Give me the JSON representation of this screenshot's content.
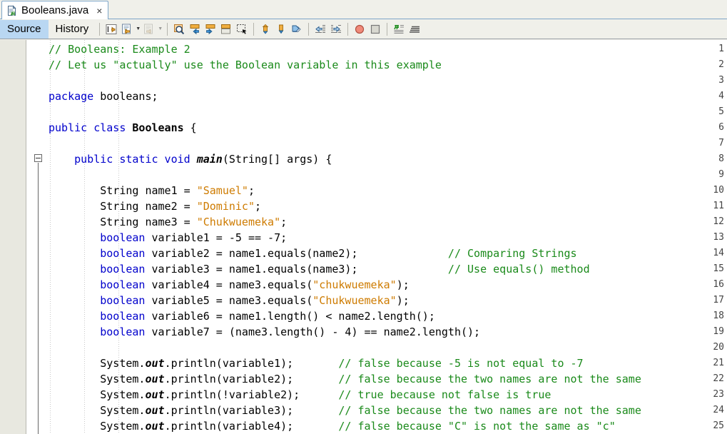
{
  "window": {
    "app": "NetBeans IDE Java Editor"
  },
  "tab": {
    "icon": "java-file-icon",
    "label": "Booleans.java",
    "close": "×"
  },
  "view_tabs": [
    {
      "label": "Source",
      "active": true
    },
    {
      "label": "History",
      "active": false
    }
  ],
  "toolbar": {
    "groups": [
      {
        "name": "navigation-history",
        "buttons": [
          {
            "name": "last-edit-button",
            "icon": "last-edit-icon",
            "enabled": true
          },
          {
            "name": "back-button",
            "icon": "back-arrow-icon",
            "enabled": true,
            "dropdown": true
          },
          {
            "name": "forward-button",
            "icon": "forward-arrow-icon",
            "enabled": false,
            "dropdown": true
          }
        ]
      },
      {
        "name": "find-and-bookmarks",
        "buttons": [
          {
            "name": "find-selection-button",
            "icon": "magnifier-icon",
            "enabled": true
          },
          {
            "name": "find-previous-button",
            "icon": "find-previous-icon",
            "enabled": true
          },
          {
            "name": "find-next-button",
            "icon": "find-next-icon",
            "enabled": true
          },
          {
            "name": "toggle-highlight-button",
            "icon": "toggle-highlight-icon",
            "enabled": true
          },
          {
            "name": "toggle-rectangular-selection-button",
            "icon": "rect-selection-icon",
            "enabled": true
          }
        ]
      },
      {
        "name": "bookmark-navigation",
        "buttons": [
          {
            "name": "previous-bookmark-button",
            "icon": "bookmark-up-icon",
            "enabled": true
          },
          {
            "name": "next-bookmark-button",
            "icon": "bookmark-down-icon",
            "enabled": true
          },
          {
            "name": "toggle-bookmark-button",
            "icon": "toggle-bookmark-icon",
            "enabled": true
          }
        ]
      },
      {
        "name": "indentation",
        "buttons": [
          {
            "name": "shift-left-button",
            "icon": "shift-left-icon",
            "enabled": true
          },
          {
            "name": "shift-right-button",
            "icon": "shift-right-icon",
            "enabled": true
          }
        ]
      },
      {
        "name": "recording",
        "buttons": [
          {
            "name": "start-macro-recording-button",
            "icon": "record-circle-icon",
            "enabled": true
          },
          {
            "name": "stop-macro-recording-button",
            "icon": "stop-square-icon",
            "enabled": true
          }
        ]
      },
      {
        "name": "formatting",
        "buttons": [
          {
            "name": "toggle-comment-button",
            "icon": "comment-lines-icon",
            "enabled": true
          },
          {
            "name": "format-button",
            "icon": "format-lines-icon",
            "enabled": true
          }
        ]
      }
    ]
  },
  "editor": {
    "first_visible_line": 1,
    "last_visible_line": 25,
    "fold_line": 8,
    "colors": {
      "keyword": "#0000cc",
      "string": "#ce7b00",
      "comment": "#1a8a1a",
      "text": "#000000",
      "background": "#ffffff",
      "gutter_background": "#e8e8e0",
      "active_tab_highlight": "#b9d7f2"
    },
    "lines": [
      {
        "n": 1,
        "tokens": [
          {
            "t": "cmt",
            "v": "// Booleans: Example 2"
          }
        ]
      },
      {
        "n": 2,
        "tokens": [
          {
            "t": "cmt",
            "v": "// Let us \"actually\" use the Boolean variable in this example"
          }
        ]
      },
      {
        "n": 3,
        "tokens": []
      },
      {
        "n": 4,
        "tokens": [
          {
            "t": "kw",
            "v": "package"
          },
          {
            "t": "p",
            "v": " booleans;"
          }
        ]
      },
      {
        "n": 5,
        "tokens": []
      },
      {
        "n": 6,
        "tokens": [
          {
            "t": "kw",
            "v": "public class"
          },
          {
            "t": "p",
            "v": " "
          },
          {
            "t": "clsname",
            "v": "Booleans"
          },
          {
            "t": "p",
            "v": " {"
          }
        ]
      },
      {
        "n": 7,
        "tokens": []
      },
      {
        "n": 8,
        "tokens": [
          {
            "t": "p",
            "v": "    "
          },
          {
            "t": "kw",
            "v": "public static void"
          },
          {
            "t": "p",
            "v": " "
          },
          {
            "t": "mth",
            "v": "main"
          },
          {
            "t": "p",
            "v": "(String[] args) {"
          }
        ]
      },
      {
        "n": 9,
        "tokens": []
      },
      {
        "n": 10,
        "tokens": [
          {
            "t": "p",
            "v": "        String name1 = "
          },
          {
            "t": "str",
            "v": "\"Samuel\""
          },
          {
            "t": "p",
            "v": ";"
          }
        ]
      },
      {
        "n": 11,
        "tokens": [
          {
            "t": "p",
            "v": "        String name2 = "
          },
          {
            "t": "str",
            "v": "\"Dominic\""
          },
          {
            "t": "p",
            "v": ";"
          }
        ]
      },
      {
        "n": 12,
        "tokens": [
          {
            "t": "p",
            "v": "        String name3 = "
          },
          {
            "t": "str",
            "v": "\"Chukwuemeka\""
          },
          {
            "t": "p",
            "v": ";"
          }
        ]
      },
      {
        "n": 13,
        "tokens": [
          {
            "t": "p",
            "v": "        "
          },
          {
            "t": "kw",
            "v": "boolean"
          },
          {
            "t": "p",
            "v": " variable1 = -5 == -7;"
          }
        ]
      },
      {
        "n": 14,
        "tokens": [
          {
            "t": "p",
            "v": "        "
          },
          {
            "t": "kw",
            "v": "boolean"
          },
          {
            "t": "p",
            "v": " variable2 = name1.equals(name2);"
          },
          {
            "t": "p",
            "v": "              "
          },
          {
            "t": "cmt",
            "v": "// Comparing Strings"
          }
        ]
      },
      {
        "n": 15,
        "tokens": [
          {
            "t": "p",
            "v": "        "
          },
          {
            "t": "kw",
            "v": "boolean"
          },
          {
            "t": "p",
            "v": " variable3 = name1.equals(name3);"
          },
          {
            "t": "p",
            "v": "              "
          },
          {
            "t": "cmt",
            "v": "// Use equals() method"
          }
        ]
      },
      {
        "n": 16,
        "tokens": [
          {
            "t": "p",
            "v": "        "
          },
          {
            "t": "kw",
            "v": "boolean"
          },
          {
            "t": "p",
            "v": " variable4 = name3.equals("
          },
          {
            "t": "str",
            "v": "\"chukwuemeka\""
          },
          {
            "t": "p",
            "v": ");"
          }
        ]
      },
      {
        "n": 17,
        "tokens": [
          {
            "t": "p",
            "v": "        "
          },
          {
            "t": "kw",
            "v": "boolean"
          },
          {
            "t": "p",
            "v": " variable5 = name3.equals("
          },
          {
            "t": "str",
            "v": "\"Chukwuemeka\""
          },
          {
            "t": "p",
            "v": ");"
          }
        ]
      },
      {
        "n": 18,
        "tokens": [
          {
            "t": "p",
            "v": "        "
          },
          {
            "t": "kw",
            "v": "boolean"
          },
          {
            "t": "p",
            "v": " variable6 = name1.length() < name2.length();"
          }
        ]
      },
      {
        "n": 19,
        "tokens": [
          {
            "t": "p",
            "v": "        "
          },
          {
            "t": "kw",
            "v": "boolean"
          },
          {
            "t": "p",
            "v": " variable7 = (name3.length() - 4) == name2.length();"
          }
        ]
      },
      {
        "n": 20,
        "tokens": []
      },
      {
        "n": 21,
        "tokens": [
          {
            "t": "p",
            "v": "        System."
          },
          {
            "t": "fld",
            "v": "out"
          },
          {
            "t": "p",
            "v": ".println(variable1);"
          },
          {
            "t": "p",
            "v": "       "
          },
          {
            "t": "cmt",
            "v": "// false because -5 is not equal to -7"
          }
        ]
      },
      {
        "n": 22,
        "tokens": [
          {
            "t": "p",
            "v": "        System."
          },
          {
            "t": "fld",
            "v": "out"
          },
          {
            "t": "p",
            "v": ".println(variable2);"
          },
          {
            "t": "p",
            "v": "       "
          },
          {
            "t": "cmt",
            "v": "// false because the two names are not the same"
          }
        ]
      },
      {
        "n": 23,
        "tokens": [
          {
            "t": "p",
            "v": "        System."
          },
          {
            "t": "fld",
            "v": "out"
          },
          {
            "t": "p",
            "v": ".println(!variable2);"
          },
          {
            "t": "p",
            "v": "      "
          },
          {
            "t": "cmt",
            "v": "// true because not false is true"
          }
        ]
      },
      {
        "n": 24,
        "tokens": [
          {
            "t": "p",
            "v": "        System."
          },
          {
            "t": "fld",
            "v": "out"
          },
          {
            "t": "p",
            "v": ".println(variable3);"
          },
          {
            "t": "p",
            "v": "       "
          },
          {
            "t": "cmt",
            "v": "// false because the two names are not the same"
          }
        ]
      },
      {
        "n": 25,
        "tokens": [
          {
            "t": "p",
            "v": "        System."
          },
          {
            "t": "fld",
            "v": "out"
          },
          {
            "t": "p",
            "v": ".println(variable4);"
          },
          {
            "t": "p",
            "v": "       "
          },
          {
            "t": "cmt",
            "v": "// false because \"C\" is not the same as \"c\""
          }
        ]
      }
    ]
  }
}
